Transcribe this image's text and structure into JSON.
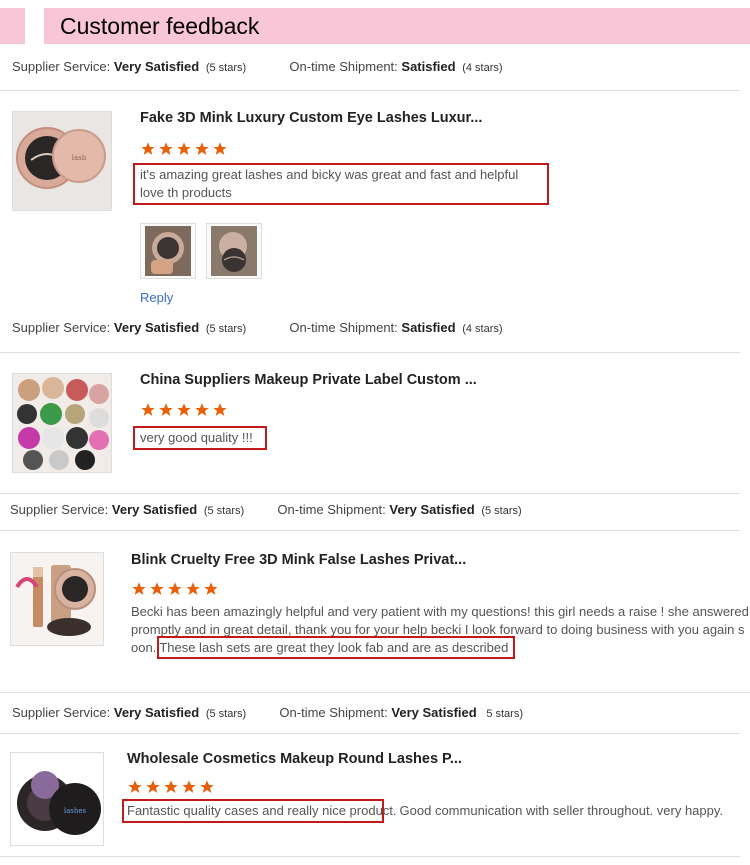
{
  "header": {
    "title": "Customer feedback"
  },
  "summary": {
    "supplier_label": "Supplier Service:",
    "supplier_value": "Very Satisfied",
    "supplier_stars": "(5 stars)",
    "shipment_label": "On-time Shipment:",
    "shipment_value": "Satisfied",
    "shipment_stars": "(4 stars)"
  },
  "reviews": [
    {
      "title": "Fake 3D Mink Luxury Custom Eye Lashes Luxur...",
      "rating": 5,
      "text_line1": "it's amazing great lashes and bicky was great and fast and helpful",
      "text_line2": "love th products",
      "reply_label": "Reply",
      "meta": {
        "supplier_label": "Supplier Service:",
        "supplier_value": "Very Satisfied",
        "supplier_stars": "(5 stars)",
        "shipment_label": "On-time Shipment:",
        "shipment_value": "Satisfied",
        "shipment_stars": "(4 stars)"
      }
    },
    {
      "title": "China Suppliers Makeup Private Label Custom ...",
      "rating": 5,
      "text": "very good quality !!!",
      "meta": {
        "supplier_label": "Supplier Service:",
        "supplier_value": "Very Satisfied",
        "supplier_stars": "(5 stars)",
        "shipment_label": "On-time Shipment:",
        "shipment_value": "Very Satisfied",
        "shipment_stars": "(5 stars)"
      }
    },
    {
      "title": "Blink Cruelty Free 3D Mink False Lashes Privat...",
      "rating": 5,
      "text_line1": "Becki has been amazingly helpful and very patient with my questions! this girl needs a raise ! she answered",
      "text_line2": "promptly and in great detail, thank you for your help becki I look forward to doing business with you again s",
      "text_line3_pre": "oon.",
      "text_line3_boxed": "These lash sets are great they look fab and are as described !",
      "meta": {
        "supplier_label": "Supplier Service:",
        "supplier_value": "Very Satisfied",
        "supplier_stars": "(5 stars)",
        "shipment_label": "On-time Shipment:",
        "shipment_value": "Very Satisfied",
        "shipment_stars": "5 stars)"
      }
    },
    {
      "title": "Wholesale Cosmetics Makeup Round Lashes P...",
      "rating": 5,
      "text_boxed": "Fantastic quality cases and really nice product.",
      "text_rest": "Good communication with seller throughout. very happy."
    }
  ],
  "colors": {
    "header_bg": "#f9c6d8",
    "star": "#e8600a",
    "highlight_border": "#c21a1a",
    "link": "#3a6bc4"
  },
  "icons": {
    "star": "star-icon"
  }
}
